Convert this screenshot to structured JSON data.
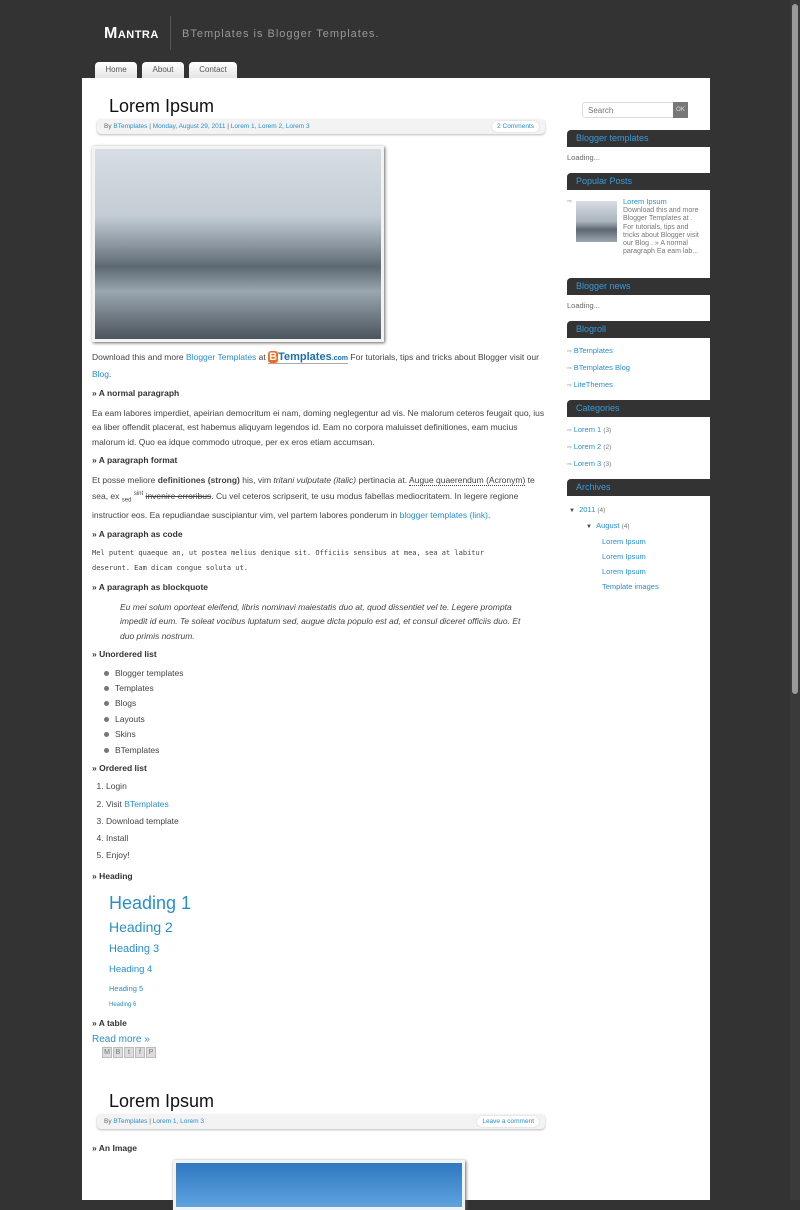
{
  "header": {
    "logo": "Mantra",
    "tagline": "BTemplates is Blogger Templates."
  },
  "nav": [
    "Home",
    "About",
    "Contact"
  ],
  "post1": {
    "title": "Lorem Ipsum",
    "meta": {
      "by": "By",
      "author": "BTemplates",
      "sep": "|",
      "date": "Monday, August 29, 2011",
      "labels": "Lorem 1, Lorem 2, Lorem 3",
      "comments": "2 Comments"
    },
    "intro": {
      "a": "Download this and more",
      "link1": "Blogger Templates",
      "b": "at",
      "logo": "BTemplates.com",
      "c": "For tutorials, tips and tricks about Blogger visit our",
      "link2": "Blog",
      "d": "."
    },
    "h_normal": "» A normal paragraph",
    "normal": "Ea eam labores imperdiet, apeirian democritum ei nam, doming neglegentur ad vis. Ne malorum ceteros feugait quo, ius ea liber offendit placerat, est habemus aliquyam legendos id. Eam no corpora maluisset definitiones, eam mucius malorum id. Quo ea idque commodo utroque, per ex eros etiam accumsan.",
    "h_format": "» A paragraph format",
    "format": {
      "a": "Et posse meliore",
      "strong": "definitiones (strong)",
      "b": "his, vim",
      "italic": "tritani vulputate (italic)",
      "c": "pertinacia at.",
      "acronym": "Augue quaerendum (Acronym)",
      "d": "te sea, ex",
      "sub": "sed",
      "sup": "sint",
      "strike": "invenire erroribus",
      "e": ". Cu vel ceteros scripserit, te usu modus fabellas mediocritatem. In legere regione instructior eos. Ea repudiandae suscipiantur vim, vel partem labores ponderum in",
      "link": "blogger templates (link)",
      "f": "."
    },
    "h_code": "» A paragraph as code",
    "code": "Mel putent quaeque an, ut postea melius denique sit. Officiis sensibus at mea, sea at labitur deserunt. Eam dicam congue soluta ut.",
    "h_quote": "» A paragraph as blockquote",
    "quote": "Eu mei solum oporteat eleifend, libris nominavi maiestatis duo at, quod dissentiet vel te. Legere prompta impedit id eum. Te soleat vocibus luptatum sed, augue dicta populo est ad, et consul diceret officiis duo. Et duo primis nostrum.",
    "h_ul": "» Unordered list",
    "ul": [
      "Blogger templates",
      "Templates",
      "Blogs",
      "Layouts",
      "Skins",
      "BTemplates"
    ],
    "h_ol": "» Ordered list",
    "ol": {
      "1": "Login",
      "2a": "Visit",
      "2b": "BTemplates",
      "3": "Download template",
      "4": "Install",
      "5": "Enjoy!"
    },
    "h_heading": "» Heading",
    "headings": [
      "Heading 1",
      "Heading 2",
      "Heading 3",
      "Heading 4",
      "Heading 5",
      "Heading 6"
    ],
    "h_table": "» A table",
    "read_more": "Read more »",
    "share_icons": [
      "email-icon",
      "blog-icon",
      "twitter-icon",
      "facebook-icon",
      "pinterest-icon"
    ]
  },
  "post2": {
    "title": "Lorem Ipsum",
    "meta": {
      "by": "By",
      "author": "BTemplates",
      "sep": "|",
      "labels": "Lorem 1, Lorem 3",
      "comments": "Leave a comment"
    },
    "h_image": "» An Image"
  },
  "sidebar": {
    "search": {
      "placeholder": "Search",
      "button": "OK"
    },
    "blogger_templates": {
      "title": "Blogger templates",
      "text": "Loading..."
    },
    "popular": {
      "title": "Popular Posts",
      "post_title": "Lorem Ipsum",
      "snippet": "Download this and more Blogger Templates at . For tutorials, tips and tricks about Blogger visit our Blog . » A normal paragraph Ea eam lab..."
    },
    "news": {
      "title": "Blogger news",
      "text": "Loading..."
    },
    "blogroll": {
      "title": "Blogroll",
      "items": [
        "BTemplates",
        "BTemplates Blog",
        "LiteThemes"
      ]
    },
    "categories": {
      "title": "Categories",
      "items": [
        {
          "name": "Lorem 1",
          "count": "(3)"
        },
        {
          "name": "Lorem 2",
          "count": "(2)"
        },
        {
          "name": "Lorem 3",
          "count": "(3)"
        }
      ]
    },
    "archives": {
      "title": "Archives",
      "year": "2011",
      "year_count": "(4)",
      "month": "August",
      "month_count": "(4)",
      "posts": [
        "Lorem Ipsum",
        "Lorem Ipsum",
        "Lorem Ipsum",
        "Template images"
      ]
    }
  },
  "colors": {
    "background": "#333333",
    "link": "#2b8fc6",
    "widget_title": "#3a9ad9"
  }
}
